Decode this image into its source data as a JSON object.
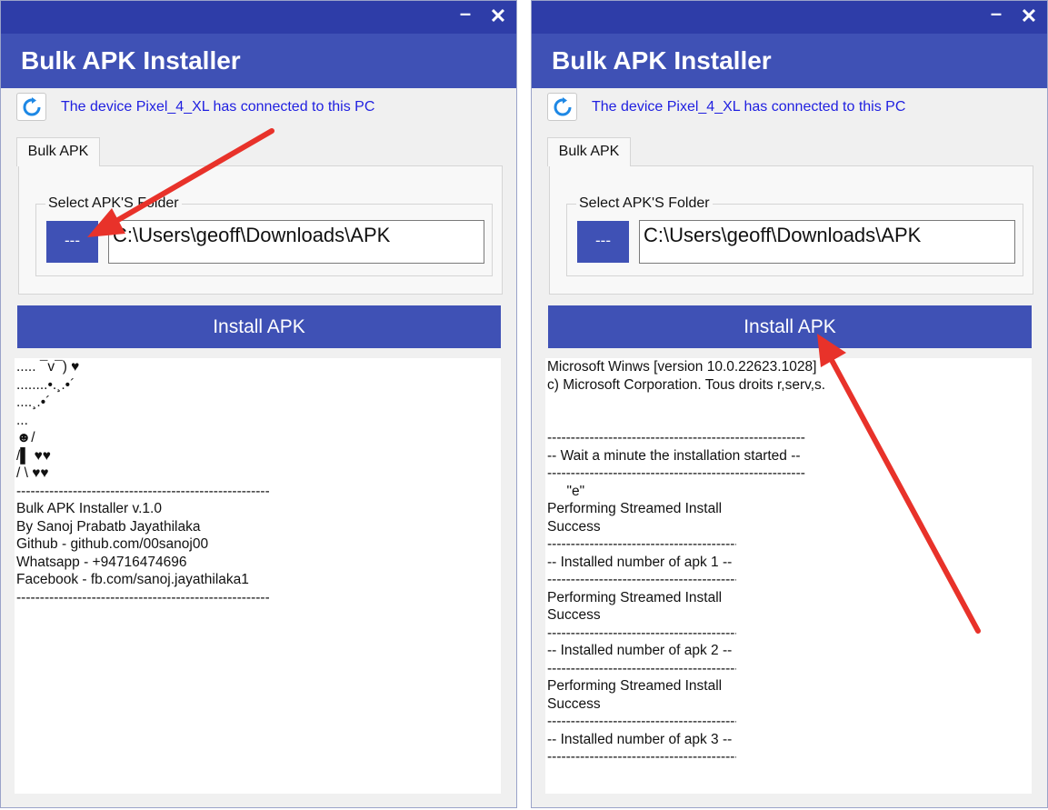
{
  "title_bar": {
    "minimize_glyph": "–",
    "close_glyph": "✕"
  },
  "colors": {
    "title_bar": "#2e3da8",
    "header": "#3f51b5",
    "button": "#3f51b5",
    "status_text": "#1f1fe0",
    "annotation_arrow": "#e8322a"
  },
  "icons": {
    "refresh": "refresh-icon",
    "minimize": "minimize-icon",
    "close": "close-icon"
  },
  "left_window": {
    "title": "Bulk APK Installer",
    "device_status": "The device Pixel_4_XL has connected to this PC",
    "tab_label": "Bulk APK",
    "group_label": "Select APK'S Folder",
    "browse_label": "---",
    "path_value": "C:\\Users\\geoff\\Downloads\\APK",
    "install_label": "Install APK",
    "console": {
      "art": [
        "..... ¯v¯) ♥",
        "........•.¸.•´",
        "....¸.•´",
        "...",
        "☻/",
        "/▌ ♥♥",
        "/ \\ ♥♥"
      ],
      "divider": "------------------------------------------------------------------------",
      "info": [
        "Bulk APK Installer v.1.0",
        "By Sanoj Prabatb Jayathilaka",
        "Github - github.com/00sanoj00",
        "Whatsapp - +94716474696",
        "Facebook - fb.com/sanoj.jayathilaka1"
      ]
    }
  },
  "right_window": {
    "title": "Bulk APK Installer",
    "device_status": "The device Pixel_4_XL has connected to this PC",
    "tab_label": "Bulk APK",
    "group_label": "Select APK'S Folder",
    "browse_label": "---",
    "path_value": "C:\\Users\\geoff\\Downloads\\APK",
    "install_label": "Install APK",
    "console": {
      "header": [
        "Microsoft Winws [version 10.0.22623.1028]",
        "c) Microsoft Corporation. Tous droits r,serv,s."
      ],
      "divider_long": "----------------------------------------------------------------------------",
      "divider_short": "------------------------------------------------------",
      "wait_message": "-- Wait a minute the installation started --",
      "quote_line": "     \"e\"",
      "install_status": "Performing Streamed Install",
      "success": "Success",
      "installed": [
        "-- Installed number of apk 1 --",
        "-- Installed number of apk 2 --",
        "-- Installed number of apk 3 --"
      ]
    }
  }
}
